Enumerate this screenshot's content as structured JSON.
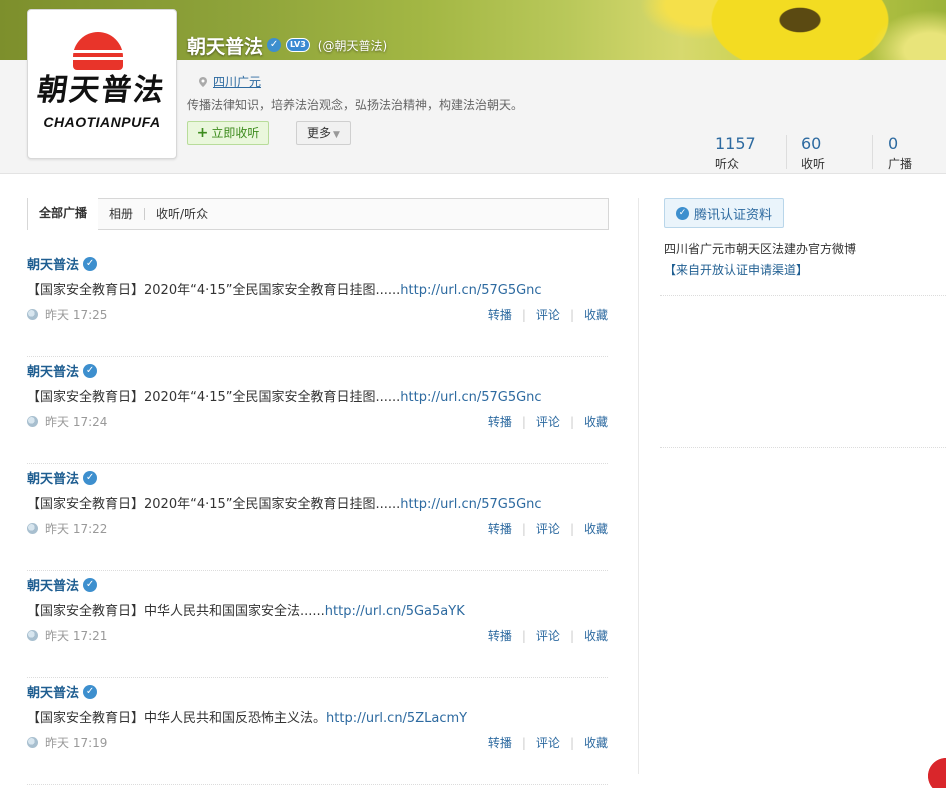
{
  "profile": {
    "name": "朝天普法",
    "level_badge": "LV3",
    "handle": "(@朝天普法)",
    "location": "四川广元",
    "bio": "传播法律知识，培养法治观念，弘扬法治精神，构建法治朝天。",
    "follow_label": "立即收听",
    "more_label": "更多",
    "avatar_title": "朝天普法",
    "avatar_subtitle": "CHAOTIANPUFA"
  },
  "stats": [
    {
      "value": "1157",
      "label": "听众"
    },
    {
      "value": "60",
      "label": "收听"
    },
    {
      "value": "0",
      "label": "广播"
    }
  ],
  "tabs": [
    "全部广播",
    "相册",
    "收听/听众"
  ],
  "posts": [
    {
      "author": "朝天普法",
      "text": "【国家安全教育日】2020年“4·15”全民国家安全教育日挂图......",
      "link": "http://url.cn/57G5Gnc",
      "time": "昨天 17:25"
    },
    {
      "author": "朝天普法",
      "text": "【国家安全教育日】2020年“4·15”全民国家安全教育日挂图......",
      "link": "http://url.cn/57G5Gnc",
      "time": "昨天 17:24"
    },
    {
      "author": "朝天普法",
      "text": "【国家安全教育日】2020年“4·15”全民国家安全教育日挂图......",
      "link": "http://url.cn/57G5Gnc",
      "time": "昨天 17:22"
    },
    {
      "author": "朝天普法",
      "text": "【国家安全教育日】中华人民共和国国家安全法......",
      "link": "http://url.cn/5Ga5aYK",
      "time": "昨天 17:21"
    },
    {
      "author": "朝天普法",
      "text": "【国家安全教育日】中华人民共和国反恐怖主义法。",
      "link": "http://url.cn/5ZLacmY",
      "time": "昨天 17:19"
    }
  ],
  "post_actions": {
    "repost": "转播",
    "comment": "评论",
    "favorite": "收藏"
  },
  "verification": {
    "button_label": "腾讯认证资料",
    "description": "四川省广元市朝天区法建办官方微博",
    "source_link": "【来自开放认证申请渠道】"
  },
  "colors": {
    "link": "#2d6aa0",
    "author": "#1f5e91",
    "follow_green": "#3d8b1e"
  }
}
